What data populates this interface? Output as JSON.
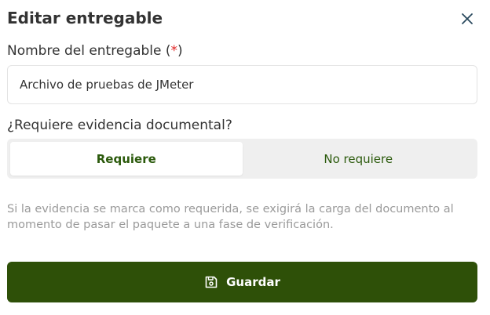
{
  "dialog": {
    "title": "Editar entregable",
    "close_icon": "close-icon"
  },
  "name_field": {
    "label": "Nombre del entregable (",
    "required_mark": "*",
    "label_suffix": ")",
    "value": "Archivo de pruebas de JMeter"
  },
  "evidence": {
    "label": "¿Requiere evidencia documental?",
    "options": [
      "Requiere",
      "No requiere"
    ],
    "selected": "Requiere",
    "hint": "Si la evidencia se marca como requerida, se exigirá la carga del documento al momento de pasar el paquete a una fase de verificación."
  },
  "save_button": {
    "label": "Guardar",
    "icon": "save-icon"
  },
  "colors": {
    "primary": "#2e5008",
    "accent_text": "#2b5a0c",
    "required": "#e02424"
  }
}
